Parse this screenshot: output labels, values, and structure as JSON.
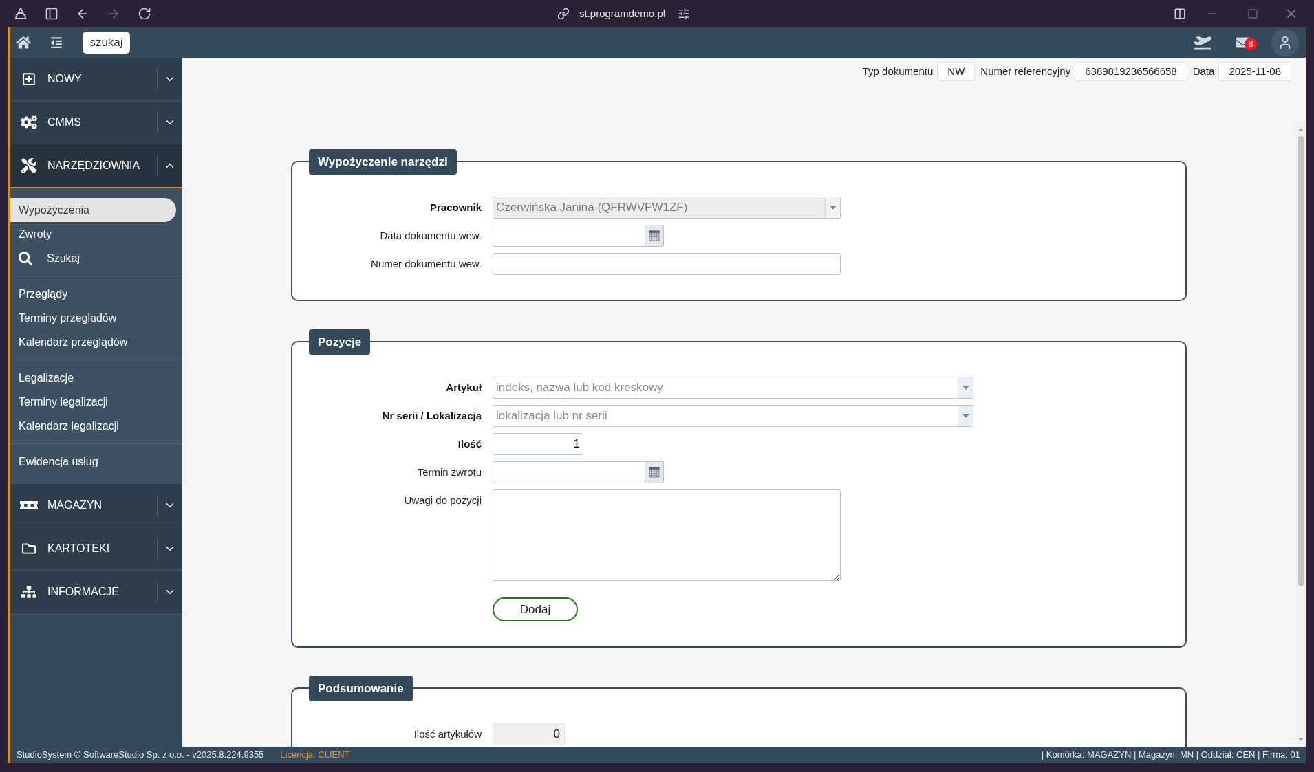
{
  "browser": {
    "url": "st.programdemo.pl"
  },
  "header": {
    "search": {
      "placeholder": "szukaj"
    },
    "mail_badge": "8"
  },
  "sidebar": {
    "sections": [
      {
        "label": "NOWY",
        "expanded": false
      },
      {
        "label": "CMMS",
        "expanded": false
      },
      {
        "label": "NARZĘDZIOWNIA",
        "expanded": true,
        "groups": [
          {
            "items": [
              {
                "label": "Wypożyczenia",
                "kind": "link",
                "selected": true
              },
              {
                "label": "Zwroty",
                "kind": "link",
                "selected": false
              },
              {
                "label": "Szukaj",
                "kind": "search",
                "selected": false
              }
            ]
          },
          {
            "items": [
              {
                "label": "Przeglądy",
                "kind": "link",
                "selected": false
              },
              {
                "label": "Terminy przegladów",
                "kind": "link",
                "selected": false
              },
              {
                "label": "Kalendarz przeglądów",
                "kind": "link",
                "selected": false
              }
            ]
          },
          {
            "items": [
              {
                "label": "Legalizacje",
                "kind": "link",
                "selected": false
              },
              {
                "label": "Terminy legalizacji",
                "kind": "link",
                "selected": false
              },
              {
                "label": "Kalendarz legalizacji",
                "kind": "link",
                "selected": false
              }
            ]
          },
          {
            "items": [
              {
                "label": "Ewidencja usług",
                "kind": "link",
                "selected": false
              }
            ]
          }
        ]
      },
      {
        "label": "MAGAZYN",
        "expanded": false
      },
      {
        "label": "KARTOTEKI",
        "expanded": false
      },
      {
        "label": "INFORMACJE",
        "expanded": false
      }
    ]
  },
  "document_info": [
    {
      "label": "Typ dokumentu",
      "value": "NW"
    },
    {
      "label": "Numer referencyjny",
      "value": "6389819236566658"
    },
    {
      "label": "Data",
      "value": "2025-11-08"
    }
  ],
  "sections": [
    {
      "title": "Wypożyczenie narzędzi",
      "fields": [
        {
          "kind": "select",
          "label": "Pracownik",
          "required": true,
          "disabled": true,
          "value": "Czerwińska Janina (QFRWVFW1ZF)"
        },
        {
          "kind": "date",
          "label": "Data dokumentu wew.",
          "required": false
        },
        {
          "kind": "text",
          "label": "Numer dokumentu wew.",
          "required": false
        }
      ]
    },
    {
      "title": "Pozycje",
      "fields": [
        {
          "kind": "select",
          "label": "Artykuł",
          "required": true,
          "disabled": false,
          "placeholder": "indeks, nazwa lub kod kreskowy"
        },
        {
          "kind": "select",
          "label": "Nr serii / Lokalizacja",
          "required": true,
          "disabled": false,
          "placeholder": "lokalizacja lub nr serii"
        },
        {
          "kind": "number",
          "label": "Ilość",
          "required": true,
          "value": "1"
        },
        {
          "kind": "date",
          "label": "Termin zwrotu",
          "required": false
        },
        {
          "kind": "textarea",
          "label": "Uwagi do pozycji",
          "required": false
        }
      ],
      "button": "Dodaj"
    },
    {
      "title": "Podsumowanie",
      "fields": [
        {
          "kind": "readonly",
          "label": "Ilość artykułów",
          "required": false,
          "value": "0"
        }
      ]
    }
  ],
  "status_bar": {
    "left": "StudioSystem © SoftwareStudio Sp. z o.o. - v2025.8.224.9355",
    "license": "Licencja: CLIENT",
    "right": "| Komórka: MAGAZYN | Magazyn: MN | Oddział: CEN | Firma: 01"
  }
}
